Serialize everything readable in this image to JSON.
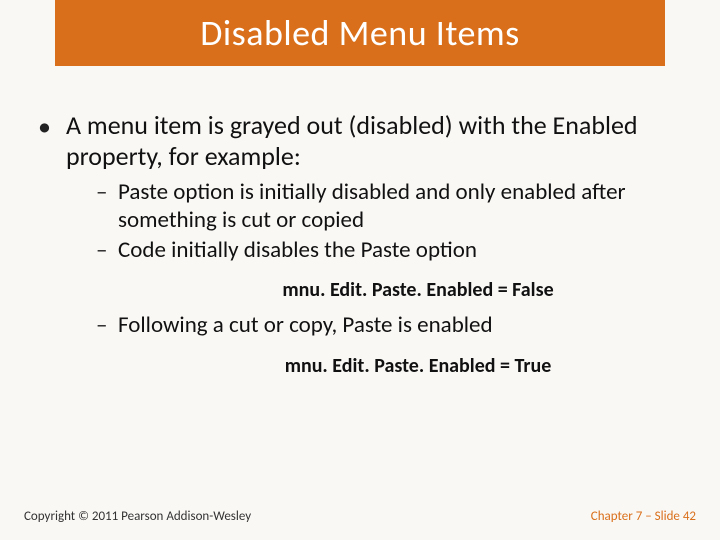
{
  "title": "Disabled Menu Items",
  "bullet1": "A menu item is grayed out (disabled) with the Enabled property, for example:",
  "sub1": "Paste option is initially disabled and only enabled after something is cut or copied",
  "sub2": "Code initially disables the Paste option",
  "code1": "mnu. Edit. Paste. Enabled = False",
  "sub3": "Following a cut or copy, Paste is enabled",
  "code2": "mnu. Edit. Paste. Enabled = True",
  "copyright": "Copyright © 2011 Pearson Addison-Wesley",
  "chapter": "Chapter 7 – Slide 42"
}
